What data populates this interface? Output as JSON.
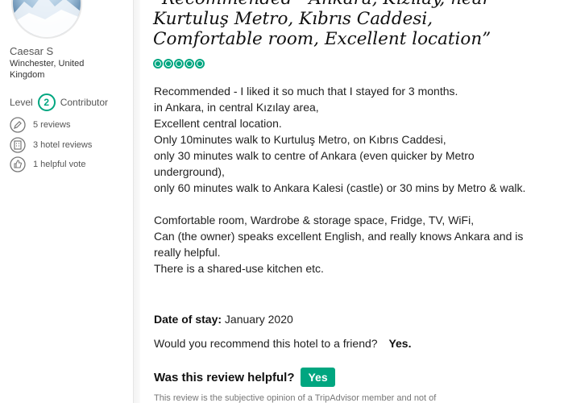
{
  "user": {
    "name": "Caesar S",
    "location": "Winchester, United Kingdom",
    "level_prefix": "Level",
    "level": "2",
    "level_suffix": "Contributor",
    "stats": [
      {
        "icon": "pencil-icon",
        "text": "5 reviews"
      },
      {
        "icon": "hotel-icon",
        "text": "3 hotel reviews"
      },
      {
        "icon": "thumbs-up-icon",
        "text": "1 helpful vote"
      }
    ]
  },
  "review": {
    "title": "“Recommended - Ankara, Kızılay, near Kurtuluş Metro, Kıbrıs Caddesi, Comfortable room, Excellent location”",
    "rating_bubbles": 5,
    "lines_a": [
      "Recommended - I liked it so much that I stayed for 3 months.",
      "in Ankara, in central Kızılay area,",
      "Excellent central location.",
      "Only 10minutes walk to Kurtuluş Metro, on Kıbrıs Caddesi,",
      "only 30 minutes walk to centre of Ankara (even quicker by Metro underground),",
      "only 60 minutes walk to Ankara Kalesi (castle) or 30 mins by Metro & walk."
    ],
    "lines_b": [
      "Comfortable room, Wardrobe & storage space, Fridge, TV, WiFi,",
      "Can (the owner) speaks excellent English, and really knows Ankara and is really helpful.",
      "There is a shared-use kitchen etc."
    ],
    "date_label": "Date of stay:",
    "date_value": "January 2020",
    "recommend_q": "Would you recommend this hotel to a friend?",
    "recommend_a": "Yes.",
    "helpful_q": "Was this review helpful?",
    "helpful_btn": "Yes",
    "disclaimer": "This review is the subjective opinion of a TripAdvisor member and not of"
  },
  "colors": {
    "accent": "#00a680"
  }
}
